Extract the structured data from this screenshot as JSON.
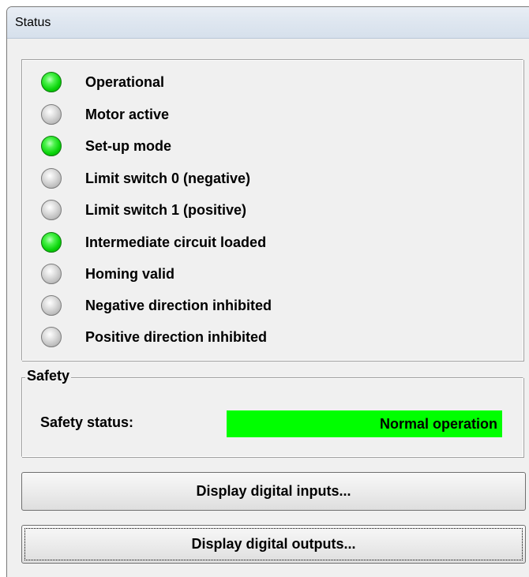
{
  "window": {
    "title": "Status"
  },
  "status": {
    "items": [
      {
        "label": "Operational",
        "state": "on"
      },
      {
        "label": "Motor active",
        "state": "off"
      },
      {
        "label": "Set-up mode",
        "state": "on"
      },
      {
        "label": "Limit switch 0 (negative)",
        "state": "off"
      },
      {
        "label": "Limit switch 1 (positive)",
        "state": "off"
      },
      {
        "label": "Intermediate circuit loaded",
        "state": "on"
      },
      {
        "label": "Homing valid",
        "state": "off"
      },
      {
        "label": "Negative direction inhibited",
        "state": "off"
      },
      {
        "label": "Positive direction inhibited",
        "state": "off"
      }
    ]
  },
  "safety": {
    "group_label": "Safety",
    "status_label": "Safety status:",
    "status_value": "Normal operation",
    "status_color": "#00ff00"
  },
  "buttons": {
    "inputs_label": "Display digital inputs...",
    "outputs_label": "Display digital outputs..."
  },
  "colors": {
    "led_on": "#0ad40a",
    "led_off": "#bdbdbd"
  }
}
